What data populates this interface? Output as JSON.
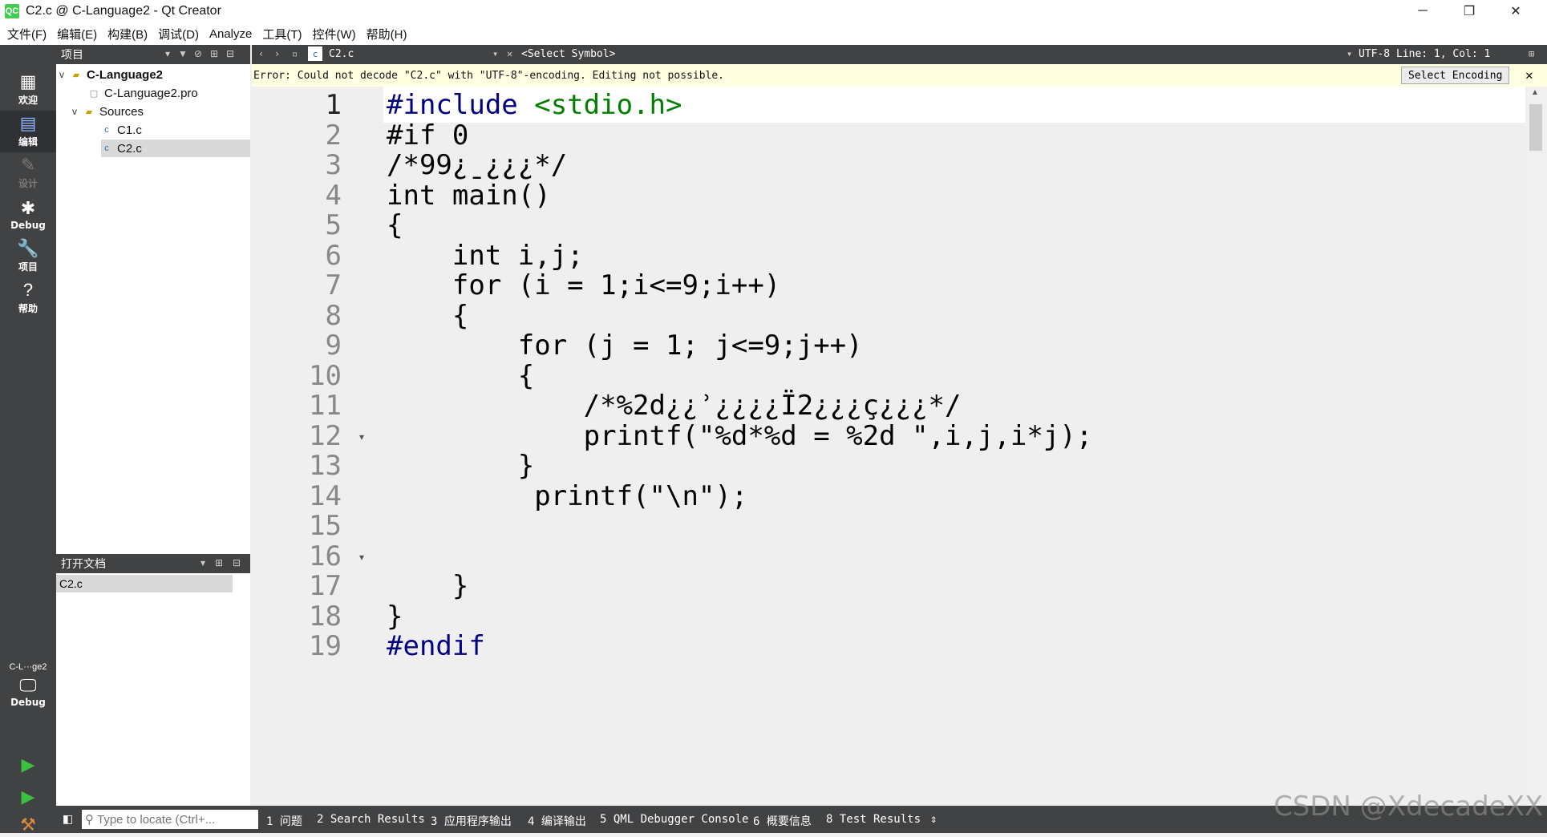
{
  "window": {
    "app_icon": "QC",
    "title": "C2.c @ C-Language2 - Qt Creator",
    "minimize": "─",
    "restore": "❐",
    "close": "✕"
  },
  "menu": [
    "文件(F)",
    "编辑(E)",
    "构建(B)",
    "调试(D)",
    "Analyze",
    "工具(T)",
    "控件(W)",
    "帮助(H)"
  ],
  "modes": {
    "welcome": "欢迎",
    "edit": "编辑",
    "design": "设计",
    "debug": "Debug",
    "projects": "项目",
    "help": "帮助"
  },
  "kit": {
    "name": "C-L···ge2",
    "mode": "Debug"
  },
  "projects_pane": {
    "title": "项目",
    "tree": {
      "project": "C-Language2",
      "pro_file": "C-Language2.pro",
      "sources": "Sources",
      "files": [
        "C1.c",
        "C2.c"
      ]
    }
  },
  "open_docs": {
    "title": "打开文档",
    "items": [
      "C2.c"
    ]
  },
  "editor_toolbar": {
    "file": "C2.c",
    "symbol": "<Select Symbol>",
    "status": "UTF-8 Line: 1, Col: 1"
  },
  "error_bar": {
    "message": "Error: Could not decode \"C2.c\" with \"UTF-8\"-encoding. Editing not possible.",
    "button": "Select Encoding"
  },
  "code": {
    "lines": [
      "#include <stdio.h>",
      "#if 0",
      "/*99¿ˍ¿¿¿*/",
      "int main()",
      "{",
      "    int i,j;",
      "    for (i = 1;i<=9;i++)",
      "    {",
      "        for (j = 1; j<=9;j++)",
      "        {",
      "            /*%2d¿¿ʾ¿¿¿¿Ï2¿¿¿ҫ¿¿¿*/",
      "            printf(\"%d*%d = %2d \",i,j,i*j);",
      "        }",
      "         printf(\"\\n\");",
      "",
      "",
      "    }",
      "}",
      "#endif"
    ],
    "current_line": 1,
    "colors": {
      "keyword": "#000080",
      "string": "#008000",
      "preprocessor": "#000080"
    }
  },
  "output_tabs": [
    "1 问题",
    "2 Search Results",
    "3 应用程序输出",
    "4 编译输出",
    "5 QML Debugger Console",
    "6 概要信息",
    "8 Test Results"
  ],
  "locate": {
    "placeholder": "Type to locate (Ctrl+..."
  },
  "watermark": "CSDN @XdecadeXX"
}
